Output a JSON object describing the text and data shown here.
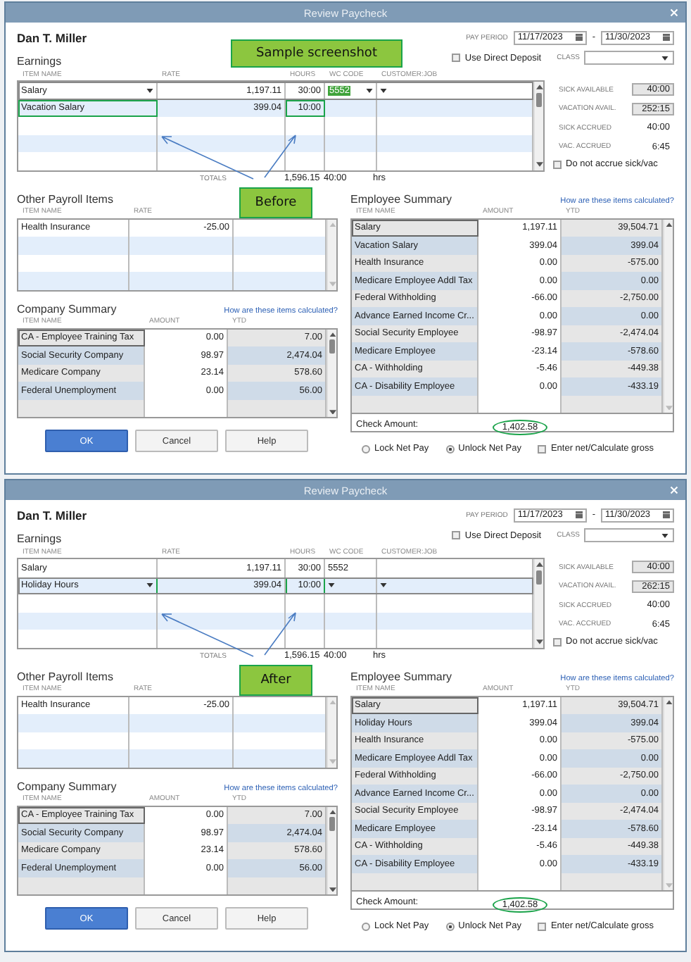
{
  "windows": [
    {
      "title": "Review Paycheck",
      "employee": "Dan T. Miller",
      "callouts": [
        {
          "text": "Sample screenshot",
          "kind": "banner"
        },
        {
          "text": "Before",
          "kind": "pointer"
        }
      ],
      "pay_period": {
        "label": "PAY PERIOD",
        "from": "11/17/2023",
        "separator": "-",
        "to": "11/30/2023"
      },
      "direct_deposit": {
        "label": "Use Direct Deposit",
        "checked": false
      },
      "class_label": "CLASS",
      "earnings": {
        "title": "Earnings",
        "columns": [
          "ITEM NAME",
          "RATE",
          "HOURS",
          "WC CODE",
          "CUSTOMER:JOB"
        ],
        "rows": [
          {
            "item": "Salary",
            "rate": "1,197.11",
            "hours": "30:00",
            "wc_code": "5552",
            "editing": true,
            "code_selected": true,
            "marked": false
          },
          {
            "item": "Vacation Salary",
            "rate": "399.04",
            "hours": "10:00",
            "editing": false,
            "marked": true
          }
        ],
        "totals_label": "TOTALS",
        "total_amount": "1,596.15",
        "total_hours": "40:00",
        "hours_unit": "hrs"
      },
      "accruals": [
        {
          "label": "SICK AVAILABLE",
          "value": "40:00",
          "kind": "field"
        },
        {
          "label": "VACATION AVAIL.",
          "value": "252:15",
          "kind": "field"
        },
        {
          "label": "SICK ACCRUED",
          "value": "40:00",
          "kind": "text"
        },
        {
          "label": "VAC. ACCRUED",
          "value": "6:45",
          "kind": "text"
        }
      ],
      "no_accrue": {
        "label": "Do not accrue sick/vac",
        "checked": false
      },
      "other_payroll": {
        "title": "Other Payroll Items",
        "columns": [
          "ITEM NAME",
          "RATE"
        ],
        "rows": [
          {
            "item": "Health Insurance",
            "rate": "-25.00"
          }
        ]
      },
      "company_summary": {
        "title": "Company Summary",
        "link": "How are these items calculated?",
        "columns": [
          "ITEM NAME",
          "AMOUNT",
          "YTD"
        ],
        "rows": [
          {
            "item": "CA - Employee Training Tax",
            "amount": "0.00",
            "ytd": "7.00",
            "selected": true
          },
          {
            "item": "Social Security Company",
            "amount": "98.97",
            "ytd": "2,474.04",
            "selected": false
          },
          {
            "item": "Medicare Company",
            "amount": "23.14",
            "ytd": "578.60",
            "selected": false
          },
          {
            "item": "Federal Unemployment",
            "amount": "0.00",
            "ytd": "56.00",
            "selected": false
          }
        ]
      },
      "employee_summary": {
        "title": "Employee Summary",
        "link": "How are these items calculated?",
        "columns": [
          "ITEM NAME",
          "AMOUNT",
          "YTD"
        ],
        "rows": [
          {
            "item": "Salary",
            "amount": "1,197.11",
            "ytd": "39,504.71",
            "selected": true
          },
          {
            "item": "Vacation Salary",
            "amount": "399.04",
            "ytd": "399.04",
            "selected": false
          },
          {
            "item": "Health Insurance",
            "amount": "0.00",
            "ytd": "-575.00",
            "selected": false
          },
          {
            "item": "Medicare Employee Addl Tax",
            "amount": "0.00",
            "ytd": "0.00",
            "selected": false
          },
          {
            "item": "Federal Withholding",
            "amount": "-66.00",
            "ytd": "-2,750.00",
            "selected": false
          },
          {
            "item": "Advance Earned Income Cr...",
            "amount": "0.00",
            "ytd": "0.00",
            "selected": false
          },
          {
            "item": "Social Security Employee",
            "amount": "-98.97",
            "ytd": "-2,474.04",
            "selected": false
          },
          {
            "item": "Medicare Employee",
            "amount": "-23.14",
            "ytd": "-578.60",
            "selected": false
          },
          {
            "item": "CA - Withholding",
            "amount": "-5.46",
            "ytd": "-449.38",
            "selected": false
          },
          {
            "item": "CA - Disability Employee",
            "amount": "0.00",
            "ytd": "-433.19",
            "selected": false
          }
        ],
        "check_label": "Check Amount:",
        "check_amount": "1,402.58",
        "circled": true
      },
      "buttons": [
        {
          "label": "OK",
          "primary": true
        },
        {
          "label": "Cancel",
          "primary": false
        },
        {
          "label": "Help",
          "primary": false
        }
      ],
      "pay_options": [
        {
          "label": "Lock Net Pay",
          "selected": false
        },
        {
          "label": "Unlock Net Pay",
          "selected": true
        }
      ],
      "enter_net": {
        "label": "Enter net/Calculate gross",
        "checked": false
      }
    },
    {
      "title": "Review Paycheck",
      "employee": "Dan T. Miller",
      "callouts": [
        {
          "text": "After",
          "kind": "pointer"
        }
      ],
      "pay_period": {
        "label": "PAY PERIOD",
        "from": "11/17/2023",
        "separator": "-",
        "to": "11/30/2023"
      },
      "direct_deposit": {
        "label": "Use Direct Deposit",
        "checked": false
      },
      "class_label": "CLASS",
      "earnings": {
        "title": "Earnings",
        "columns": [
          "ITEM NAME",
          "RATE",
          "HOURS",
          "WC CODE",
          "CUSTOMER:JOB"
        ],
        "rows": [
          {
            "item": "Salary",
            "rate": "1,197.11",
            "hours": "30:00",
            "wc_code": "5552",
            "editing": false,
            "code_selected": false,
            "marked": false
          },
          {
            "item": "Holiday Hours",
            "rate": "399.04",
            "hours": "10:00",
            "editing": true,
            "marked": true
          }
        ],
        "totals_label": "TOTALS",
        "total_amount": "1,596.15",
        "total_hours": "40:00",
        "hours_unit": "hrs"
      },
      "accruals": [
        {
          "label": "SICK AVAILABLE",
          "value": "40:00",
          "kind": "field"
        },
        {
          "label": "VACATION AVAIL.",
          "value": "262:15",
          "kind": "field"
        },
        {
          "label": "SICK ACCRUED",
          "value": "40:00",
          "kind": "text"
        },
        {
          "label": "VAC. ACCRUED",
          "value": "6:45",
          "kind": "text"
        }
      ],
      "no_accrue": {
        "label": "Do not accrue sick/vac",
        "checked": false
      },
      "other_payroll": {
        "title": "Other Payroll Items",
        "columns": [
          "ITEM NAME",
          "RATE"
        ],
        "rows": [
          {
            "item": "Health Insurance",
            "rate": "-25.00"
          }
        ]
      },
      "company_summary": {
        "title": "Company Summary",
        "link": "How are these items calculated?",
        "columns": [
          "ITEM NAME",
          "AMOUNT",
          "YTD"
        ],
        "rows": [
          {
            "item": "CA - Employee Training Tax",
            "amount": "0.00",
            "ytd": "7.00",
            "selected": true
          },
          {
            "item": "Social Security Company",
            "amount": "98.97",
            "ytd": "2,474.04",
            "selected": false
          },
          {
            "item": "Medicare Company",
            "amount": "23.14",
            "ytd": "578.60",
            "selected": false
          },
          {
            "item": "Federal Unemployment",
            "amount": "0.00",
            "ytd": "56.00",
            "selected": false
          }
        ]
      },
      "employee_summary": {
        "title": "Employee Summary",
        "link": "How are these items calculated?",
        "columns": [
          "ITEM NAME",
          "AMOUNT",
          "YTD"
        ],
        "rows": [
          {
            "item": "Salary",
            "amount": "1,197.11",
            "ytd": "39,504.71",
            "selected": true
          },
          {
            "item": "Holiday Hours",
            "amount": "399.04",
            "ytd": "399.04",
            "selected": false
          },
          {
            "item": "Health Insurance",
            "amount": "0.00",
            "ytd": "-575.00",
            "selected": false
          },
          {
            "item": "Medicare Employee Addl Tax",
            "amount": "0.00",
            "ytd": "0.00",
            "selected": false
          },
          {
            "item": "Federal Withholding",
            "amount": "-66.00",
            "ytd": "-2,750.00",
            "selected": false
          },
          {
            "item": "Advance Earned Income Cr...",
            "amount": "0.00",
            "ytd": "0.00",
            "selected": false
          },
          {
            "item": "Social Security Employee",
            "amount": "-98.97",
            "ytd": "-2,474.04",
            "selected": false
          },
          {
            "item": "Medicare Employee",
            "amount": "-23.14",
            "ytd": "-578.60",
            "selected": false
          },
          {
            "item": "CA - Withholding",
            "amount": "-5.46",
            "ytd": "-449.38",
            "selected": false
          },
          {
            "item": "CA - Disability Employee",
            "amount": "0.00",
            "ytd": "-433.19",
            "selected": false
          }
        ],
        "check_label": "Check Amount:",
        "check_amount": "1,402.58",
        "circled": true
      },
      "buttons": [
        {
          "label": "OK",
          "primary": true
        },
        {
          "label": "Cancel",
          "primary": false
        },
        {
          "label": "Help",
          "primary": false
        }
      ],
      "pay_options": [
        {
          "label": "Lock Net Pay",
          "selected": false
        },
        {
          "label": "Unlock Net Pay",
          "selected": true
        }
      ],
      "enter_net": {
        "label": "Enter net/Calculate gross",
        "checked": false
      }
    }
  ]
}
